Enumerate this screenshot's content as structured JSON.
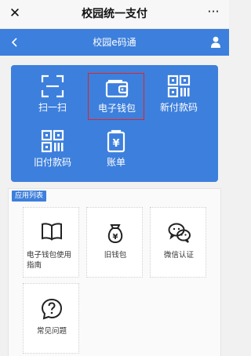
{
  "wechat_bar": {
    "title": "校园统一支付",
    "close_symbol": "✕",
    "more_symbol": "···"
  },
  "app_bar": {
    "title": "校园e码通",
    "back_icon": "chevron-left-icon",
    "user_icon": "user-icon"
  },
  "quick_actions": [
    {
      "label": "扫一扫",
      "icon": "scan-icon"
    },
    {
      "label": "电子钱包",
      "icon": "wallet-icon",
      "highlighted": true
    },
    {
      "label": "新付款码",
      "icon": "qr-code-icon"
    },
    {
      "label": "旧付款码",
      "icon": "qr-code-icon"
    },
    {
      "label": "账单",
      "icon": "bill-icon"
    }
  ],
  "apps_section": {
    "badge": "应用列表",
    "items": [
      {
        "label": "电子钱包使用指南",
        "icon": "book-icon"
      },
      {
        "label": "旧钱包",
        "icon": "money-bag-icon"
      },
      {
        "label": "微信认证",
        "icon": "wechat-icon"
      },
      {
        "label": "常见问题",
        "icon": "question-icon"
      }
    ]
  },
  "colors": {
    "primary": "#3d7fdc",
    "highlight_border": "#e02525",
    "page_bg": "#f1f1f1"
  }
}
